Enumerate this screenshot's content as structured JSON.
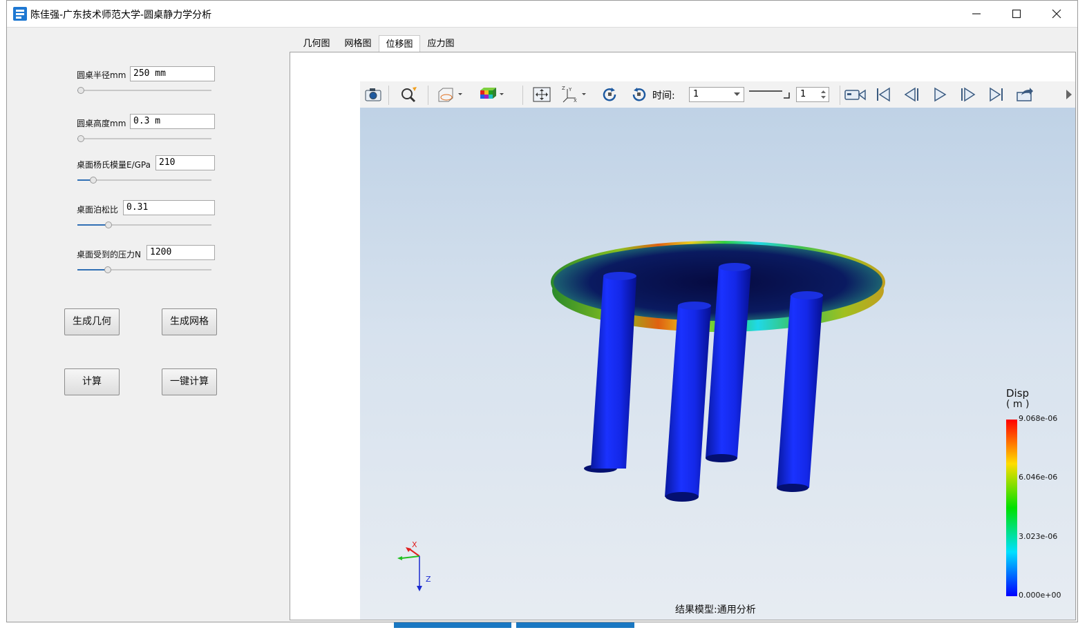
{
  "window": {
    "title": "陈佳强-广东技术师范大学-圆桌静力学分析",
    "controls": [
      "minimize-icon",
      "maximize-icon",
      "close-icon"
    ]
  },
  "params": [
    {
      "label": "圆桌半径mm",
      "value": "250 mm",
      "slider_fraction": 0.0
    },
    {
      "label": "圆桌高度mm",
      "value": "0.3 m",
      "slider_fraction": 0.0
    },
    {
      "label": "桌面杨氏模量E/GPa",
      "value": "210",
      "slider_fraction": 0.1
    },
    {
      "label": "桌面泊松比",
      "value": "0.31",
      "slider_fraction": 0.22
    },
    {
      "label": "桌面受到的压力N",
      "value": "1200",
      "slider_fraction": 0.21
    }
  ],
  "buttons": {
    "gen_geometry": "生成几何",
    "gen_mesh": "生成网格",
    "compute": "计算",
    "one_click": "一键计算"
  },
  "tabs": [
    {
      "label": "几何图",
      "active": false
    },
    {
      "label": "网格图",
      "active": false
    },
    {
      "label": "位移图",
      "active": true
    },
    {
      "label": "应力图",
      "active": false
    }
  ],
  "toolbar": {
    "time_label": "时间:",
    "time_value": "1",
    "step_value": "1",
    "icons": [
      "camera-icon",
      "zoom-icon",
      "box-section-icon",
      "color-cube-icon",
      "fit-view-icon",
      "axes-icon",
      "rotate-cw-icon",
      "rotate-ccw-icon",
      "record-icon",
      "first-frame-icon",
      "prev-frame-icon",
      "play-icon",
      "next-frame-icon",
      "last-frame-icon",
      "export-icon"
    ]
  },
  "legend": {
    "title": "Disp",
    "unit": "( m )",
    "ticks": [
      "9.068e-06",
      "6.046e-06",
      "3.023e-06",
      "0.000e+00"
    ],
    "colors": [
      "#ff0000",
      "#ffff00",
      "#00ff00",
      "#00ffff",
      "#0000ff"
    ]
  },
  "axes": {
    "x": "X",
    "z": "Z"
  },
  "footer": "结果模型:通用分析",
  "colors": {
    "accent": "#2f6fb4",
    "leg": "#0a1ee0",
    "top": "#0b1250"
  }
}
